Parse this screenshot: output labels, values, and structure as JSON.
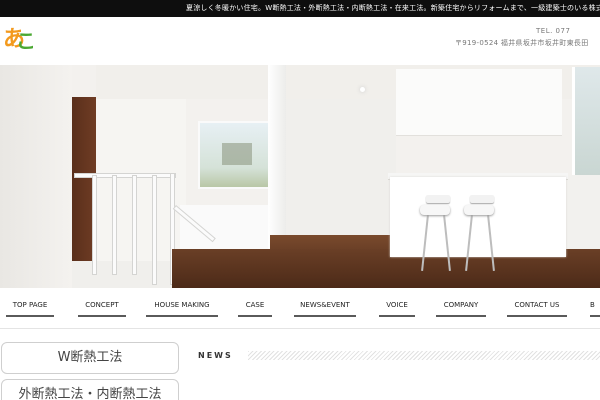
{
  "topbar": {
    "text": "夏涼しく冬暖かい住宅。W断熱工法・外断熱工法・内断熱工法・在来工法。新築住宅からリフォームまで、一級建築士のいる株式会社"
  },
  "header": {
    "logo_text": "あこ",
    "tel": "TEL. 077",
    "address": "〒919-0524 福井県坂井市坂井町東長田"
  },
  "nav": {
    "items": [
      {
        "label": "TOP PAGE"
      },
      {
        "label": "CONCEPT"
      },
      {
        "label": "HOUSE MAKING"
      },
      {
        "label": "CASE"
      },
      {
        "label": "NEWS&EVENT"
      },
      {
        "label": "VOICE"
      },
      {
        "label": "COMPANY"
      },
      {
        "label": "CONTACT US"
      },
      {
        "label": "B"
      }
    ]
  },
  "side": {
    "w_label": "W断熱工法",
    "ext_label": "外断熱工法・内断熱工法"
  },
  "news": {
    "label": "NEWS"
  },
  "colors": {
    "topbar_bg": "#0e0e0e",
    "logo_orange": "#f39a1e",
    "logo_green": "#4aa832"
  }
}
